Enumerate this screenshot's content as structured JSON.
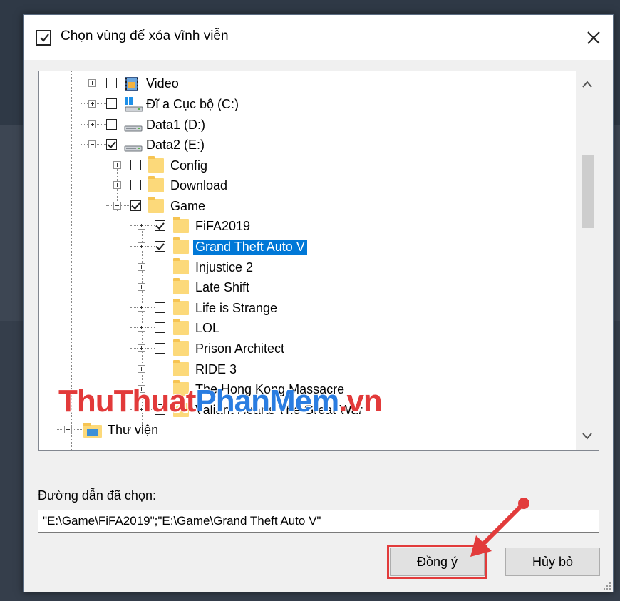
{
  "dialog": {
    "title": "Chọn vùng để xóa vĩnh viễn",
    "close_icon": "close-icon"
  },
  "tree": {
    "rows": [
      {
        "label": "Video",
        "checked": false,
        "icon": "video-library-icon"
      },
      {
        "label": "Đĩ a Cục bộ (C:)",
        "checked": false,
        "icon": "system-drive-icon"
      },
      {
        "label": "Data1 (D:)",
        "checked": false,
        "icon": "drive-icon"
      },
      {
        "label": "Data2 (E:)",
        "checked": true,
        "icon": "drive-icon"
      },
      {
        "label": "Config",
        "checked": false,
        "icon": "folder-icon"
      },
      {
        "label": "Download",
        "checked": false,
        "icon": "folder-icon"
      },
      {
        "label": "Game",
        "checked": true,
        "icon": "folder-icon"
      },
      {
        "label": "FiFA2019",
        "checked": true,
        "icon": "folder-icon"
      },
      {
        "label": "Grand Theft Auto V",
        "checked": true,
        "icon": "folder-icon",
        "selected": true
      },
      {
        "label": "Injustice 2",
        "checked": false,
        "icon": "folder-icon"
      },
      {
        "label": "Late Shift",
        "checked": false,
        "icon": "folder-icon"
      },
      {
        "label": "Life is Strange",
        "checked": false,
        "icon": "folder-icon"
      },
      {
        "label": "LOL",
        "checked": false,
        "icon": "folder-icon"
      },
      {
        "label": "Prison Architect",
        "checked": false,
        "icon": "folder-icon"
      },
      {
        "label": "RIDE 3",
        "checked": false,
        "icon": "folder-icon"
      },
      {
        "label": "The Hong Kong Massacre",
        "checked": false,
        "icon": "folder-icon"
      },
      {
        "label": "Valiant Hearts The Great War",
        "checked": false,
        "icon": "folder-icon"
      },
      {
        "label": "Thư viện",
        "checked": false,
        "icon": "library-icon"
      }
    ]
  },
  "watermark": {
    "part1": "ThuThuat",
    "part2": "PhanMem",
    "part3": ".vn"
  },
  "path": {
    "label": "Đường dẫn đã chọn:",
    "value": "\"E:\\Game\\FiFA2019\";\"E:\\Game\\Grand Theft Auto V\""
  },
  "buttons": {
    "ok": "Đồng ý",
    "cancel": "Hủy bỏ"
  },
  "colors": {
    "selection": "#0078d7",
    "highlight": "#e23b3b",
    "folder": "#fcd97a"
  }
}
